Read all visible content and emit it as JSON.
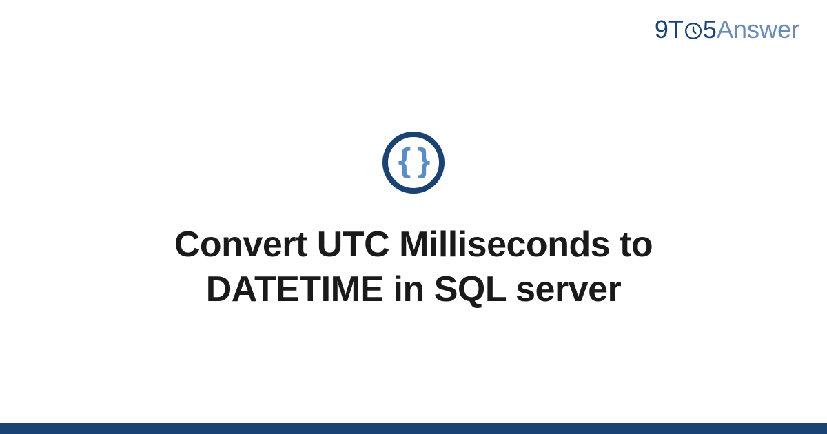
{
  "brand": {
    "part1": "9T",
    "part2": "5",
    "part3": "Answer"
  },
  "icon": {
    "braces": "{ }",
    "semantic_name": "code-braces-icon"
  },
  "title": "Convert UTC Milliseconds to DATETIME in SQL server",
  "colors": {
    "brand_primary": "#1a4272",
    "brand_secondary": "#6a8bb5",
    "accent": "#5a8cc5",
    "text": "#1a1a1a"
  }
}
